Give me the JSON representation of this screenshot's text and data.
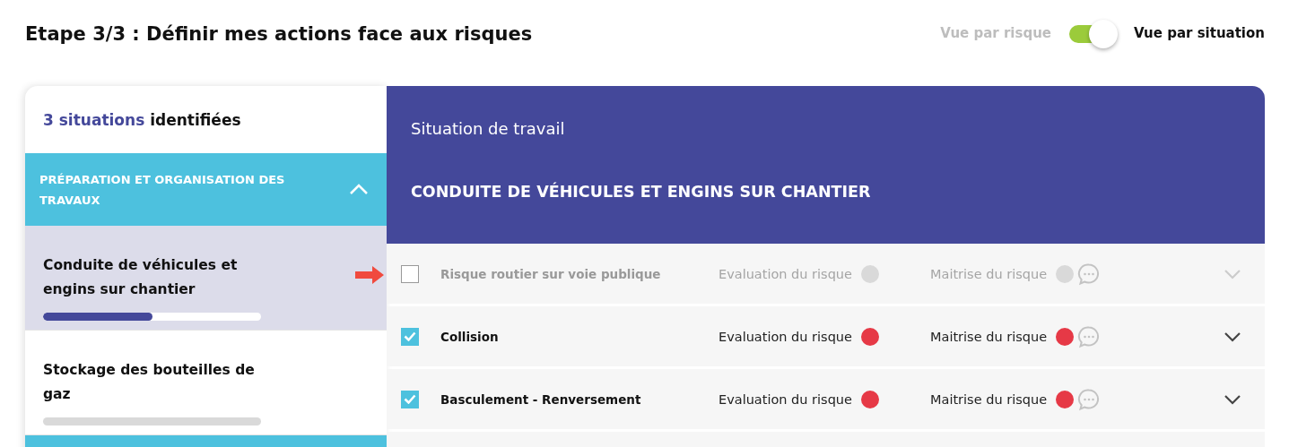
{
  "title": "Etape 3/3 : Définir mes actions face aux risques",
  "view_toggle": {
    "left_label": "Vue par risque",
    "right_label": "Vue par situation",
    "on": true
  },
  "sidebar": {
    "count_text": "3 situations",
    "count_suffix": "identifiées",
    "group": {
      "label": "PRÉPARATION ET ORGANISATION DES TRAVAUX",
      "expanded": true
    },
    "items": [
      {
        "label": "Conduite de véhicules et engins sur chantier",
        "selected": true,
        "level": 0.5
      },
      {
        "label": "Stockage des bouteilles de gaz",
        "selected": false,
        "level": 0
      }
    ]
  },
  "panel": {
    "subtitle": "Situation de travail",
    "heading": "CONDUITE DE VÉHICULES ET ENGINS SUR CHANTIER",
    "risks": [
      {
        "label": "Risque routier sur voie publique",
        "checked": false,
        "evaluation": {
          "label": "Evaluation du risque",
          "color": "#d9d9d9"
        },
        "control": {
          "label": "Maitrise du risque",
          "color": "#d9d9d9"
        }
      },
      {
        "label": "Collision",
        "checked": true,
        "evaluation": {
          "label": "Evaluation du risque",
          "color": "#e63946"
        },
        "control": {
          "label": "Maitrise du risque",
          "color": "#e63946"
        }
      },
      {
        "label": "Basculement - Renversement",
        "checked": true,
        "evaluation": {
          "label": "Evaluation du risque",
          "color": "#e63946"
        },
        "control": {
          "label": "Maitrise du risque",
          "color": "#e63946"
        }
      }
    ]
  }
}
